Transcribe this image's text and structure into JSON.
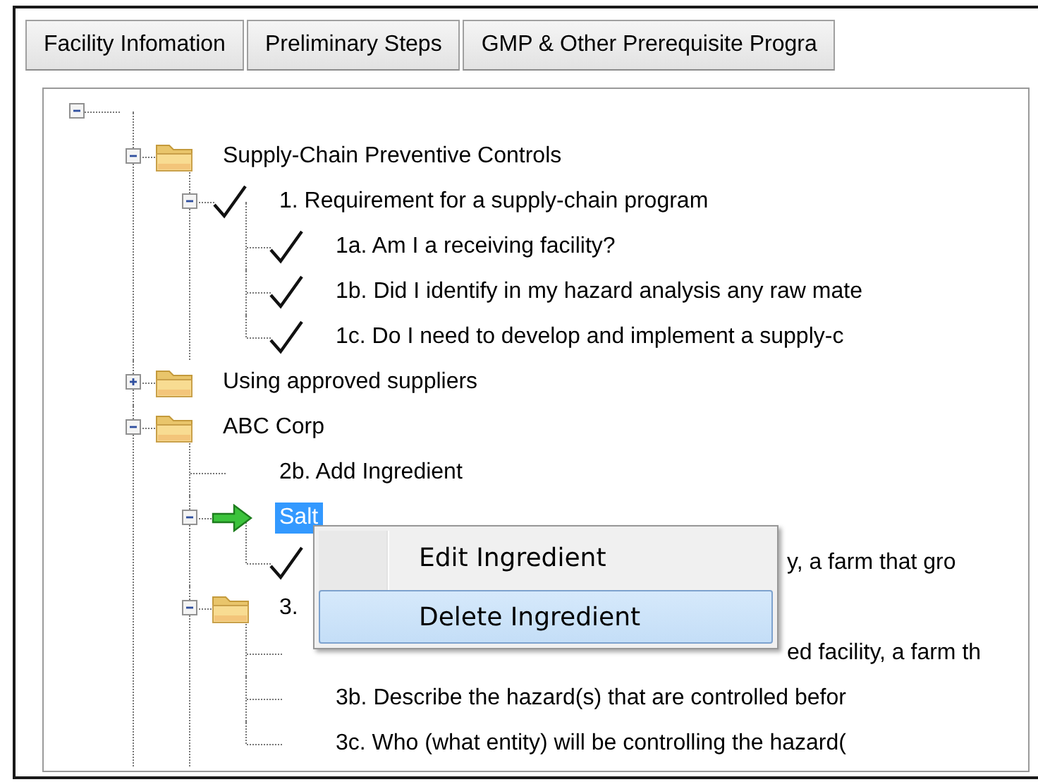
{
  "tabs": [
    {
      "label": "Facility Infomation",
      "selected": false
    },
    {
      "label": "Preliminary Steps",
      "selected": false
    },
    {
      "label": "GMP & Other Prerequisite Progra",
      "selected": false
    }
  ],
  "tree": {
    "nodes": [
      {
        "expanded": true,
        "children": [
          {
            "kind": "folder",
            "label": "Supply-Chain Preventive Controls",
            "expanded": true,
            "selected": false,
            "children": [
              {
                "kind": "check",
                "label": "1. Requirement for a supply-chain program",
                "expanded": true,
                "selected": false,
                "children": [
                  {
                    "kind": "check",
                    "label": "1a. Am I a receiving facility?",
                    "selected": false
                  },
                  {
                    "kind": "check",
                    "label": "1b. Did I identify in my hazard analysis any raw mate",
                    "selected": false
                  },
                  {
                    "kind": "check",
                    "label": "1c. Do I need to develop and implement a supply-c",
                    "selected": false
                  }
                ]
              }
            ]
          },
          {
            "kind": "folder",
            "label": "Using approved suppliers",
            "expanded": false,
            "selected": false
          },
          {
            "kind": "folder",
            "label": "ABC Corp",
            "expanded": true,
            "selected": false,
            "children": [
              {
                "kind": "plain",
                "label": "2b. Add Ingredient",
                "selected": false
              },
              {
                "kind": "arrow",
                "label": "Salt",
                "expanded": true,
                "selected": true,
                "children": [
                  {
                    "kind": "check-behind-menu",
                    "label": "y, a farm that gro",
                    "selected": false
                  }
                ]
              },
              {
                "kind": "folder",
                "label": "3.",
                "expanded": true,
                "selected": false,
                "children": [
                  {
                    "kind": "plain-behind-menu",
                    "label": "ed facility, a farm th",
                    "selected": false
                  },
                  {
                    "kind": "plain",
                    "label": "3b. Describe the hazard(s) that are controlled befor",
                    "selected": false
                  },
                  {
                    "kind": "plain",
                    "label": "3c. Who (what entity) will be controlling the hazard(",
                    "selected": false
                  }
                ]
              }
            ]
          }
        ]
      }
    ]
  },
  "context_menu": {
    "items": [
      {
        "label": "Edit Ingredient",
        "highlighted": false
      },
      {
        "label": "Delete Ingredient",
        "highlighted": true
      }
    ]
  }
}
